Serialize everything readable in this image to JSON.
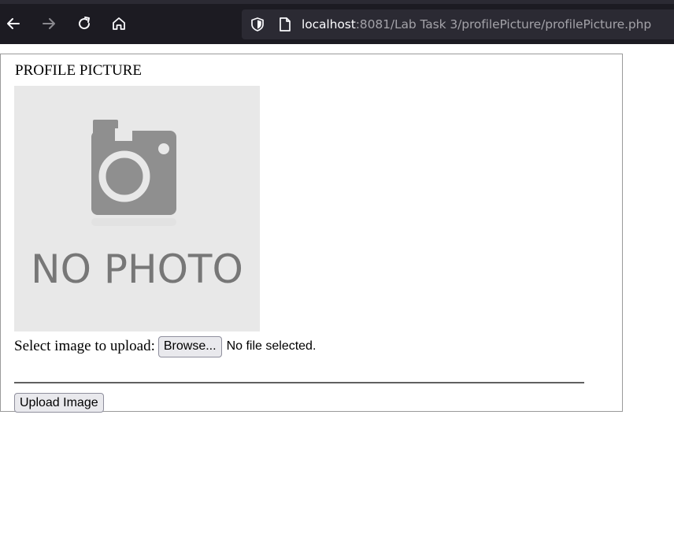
{
  "browser": {
    "url_host": "localhost",
    "url_rest": ":8081/Lab Task 3/profilePicture/profilePicture.php",
    "icons": [
      "back-arrow-icon",
      "forward-arrow-icon",
      "reload-icon",
      "home-icon",
      "shield-icon",
      "page-icon"
    ]
  },
  "form": {
    "legend": "PROFILE PICTURE",
    "photo_placeholder_text": "NO PHOTO",
    "upload_label": "Select image to upload:",
    "browse_label": "Browse...",
    "file_status": "No file selected.",
    "submit_label": "Upload Image"
  },
  "colors": {
    "browser_bg": "#1c1b22",
    "url_box_bg": "#2b2a33",
    "button_bg": "#e9e9ed",
    "photo_bg": "#e8e8e8",
    "photo_icon": "#8f8f8f"
  }
}
